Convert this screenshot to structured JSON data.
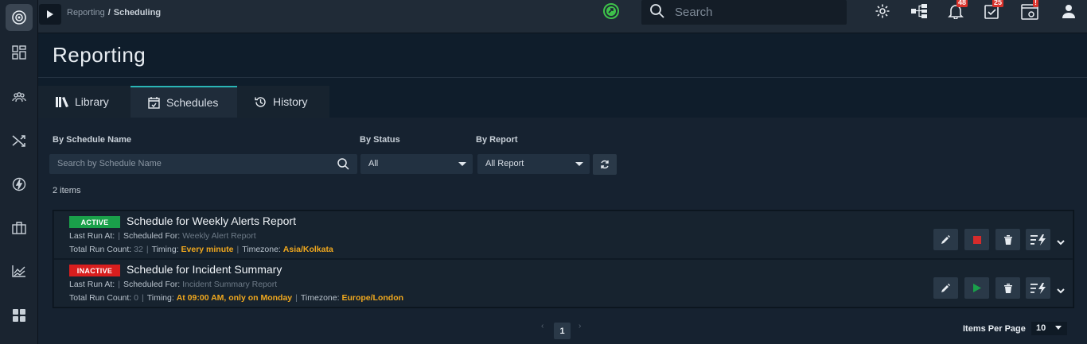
{
  "breadcrumb": {
    "parent": "Reporting",
    "separator": "/",
    "current": "Scheduling"
  },
  "search": {
    "placeholder": "Search"
  },
  "notifications": {
    "bell_count": "48",
    "tasks_count": "25",
    "system_alert": "!"
  },
  "page": {
    "title": "Reporting"
  },
  "tabs": [
    {
      "label": "Library"
    },
    {
      "label": "Schedules"
    },
    {
      "label": "History"
    }
  ],
  "filters": {
    "name_label": "By Schedule Name",
    "name_placeholder": "Search by Schedule Name",
    "status_label": "By Status",
    "status_value": "All",
    "report_label": "By Report",
    "report_value": "All Report"
  },
  "items_count": "2 items",
  "schedules": [
    {
      "status": "ACTIVE",
      "name": "Schedule for Weekly Alerts Report",
      "last_run_label": "Last Run At:",
      "scheduled_for_label": "Scheduled For:",
      "scheduled_for": "Weekly Alert Report",
      "run_count_label": "Total Run Count:",
      "run_count": "32",
      "timing_label": "Timing:",
      "timing": "Every minute",
      "timezone_label": "Timezone:",
      "timezone": "Asia/Kolkata"
    },
    {
      "status": "INACTIVE",
      "name": "Schedule for Incident Summary",
      "last_run_label": "Last Run At:",
      "scheduled_for_label": "Scheduled For:",
      "scheduled_for": "Incident Summary Report",
      "run_count_label": "Total Run Count:",
      "run_count": "0",
      "timing_label": "Timing:",
      "timing": "At 09:00 AM, only on Monday",
      "timezone_label": "Timezone:",
      "timezone": "Europe/London"
    }
  ],
  "pagination": {
    "prev": "‹",
    "current_page": "1",
    "next": "›",
    "items_per_page_label": "Items Per Page",
    "items_per_page": "10"
  },
  "colors": {
    "accent": "#2ab5b5",
    "active": "#1aa04a",
    "inactive": "#d91e1e",
    "highlight": "#f0a81e"
  }
}
